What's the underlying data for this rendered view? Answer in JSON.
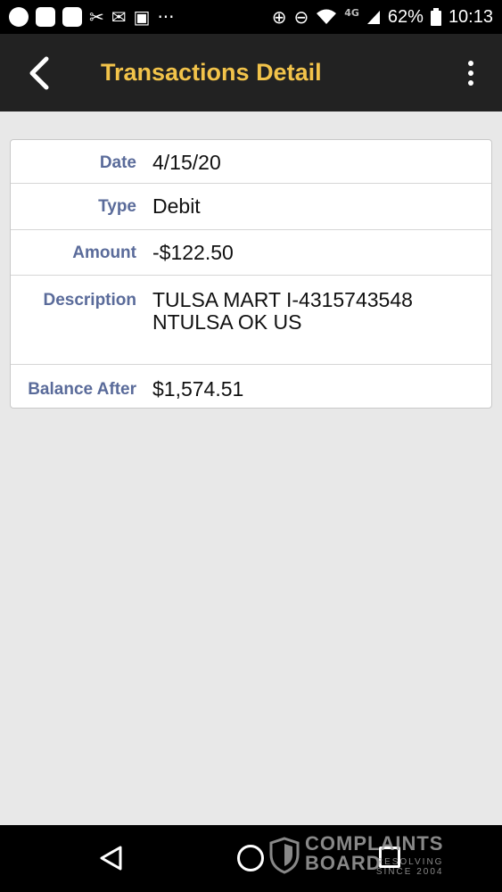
{
  "status_bar": {
    "battery": "62%",
    "time": "10:13",
    "network": "4G"
  },
  "app_bar": {
    "title": "Transactions Detail"
  },
  "details": [
    {
      "label": "Date",
      "value": "4/15/20"
    },
    {
      "label": "Type",
      "value": "Debit"
    },
    {
      "label": "Amount",
      "value": "-$122.50"
    },
    {
      "label": "Description",
      "value": "TULSA MART I-4315743548 NTULSA OK US"
    },
    {
      "label": "Balance After",
      "value": "$1,574.51"
    }
  ],
  "watermark": {
    "line1": "COMPLAINTS",
    "line2": "BOARD",
    "tagline1": "RESOLVING",
    "tagline2": "SINCE 2004"
  },
  "colors": {
    "title": "#f2c34a",
    "label": "#5a6b9a",
    "appbar": "#222222",
    "background": "#e8e8e8"
  }
}
